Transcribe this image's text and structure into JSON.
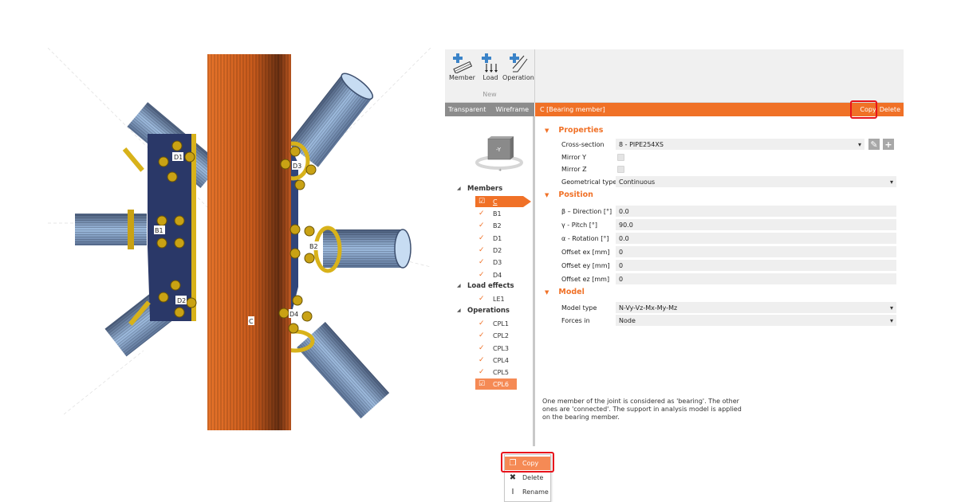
{
  "viewport": {
    "labels": {
      "column": "C",
      "d1": "D1",
      "d2": "D2",
      "d3": "D3",
      "d4": "D4",
      "b1": "B1",
      "b2": "B2"
    },
    "colors": {
      "column": "#e0661e",
      "plate": "#2d3d6e",
      "bolt": "#c8a214",
      "tube": "#8fb0d6"
    }
  },
  "ribbon": {
    "buttons": [
      {
        "label": "Member",
        "icon": "add-member-icon"
      },
      {
        "label": "Load",
        "icon": "add-load-icon"
      },
      {
        "label": "Operation",
        "icon": "add-operation-icon"
      }
    ],
    "group_label": "New"
  },
  "view_toggles": {
    "transparent": "Transparent",
    "wireframe": "Wireframe"
  },
  "view_cube": {
    "face_label": "-Y"
  },
  "tree": {
    "members": {
      "heading": "Members",
      "items": [
        "C",
        "B1",
        "B2",
        "D1",
        "D2",
        "D3",
        "D4"
      ],
      "selected": "C"
    },
    "load_effects": {
      "heading": "Load effects",
      "items": [
        "LE1"
      ]
    },
    "operations": {
      "heading": "Operations",
      "items": [
        "CPL1",
        "CPL2",
        "CPL3",
        "CPL4",
        "CPL5",
        "CPL6"
      ],
      "highlighted": "CPL6"
    }
  },
  "context_menu": {
    "items": [
      {
        "label": "Copy",
        "icon": "copy-icon"
      },
      {
        "label": "Delete",
        "icon": "delete-icon"
      },
      {
        "label": "Rename",
        "icon": "rename-icon"
      }
    ]
  },
  "header": {
    "title": "C  [Bearing member]",
    "copy_label": "Copy",
    "delete_label": "Delete",
    "accent": "#f07127",
    "highlight": "#e8141c"
  },
  "properties": {
    "section_title": "Properties",
    "cross_section_label": "Cross-section",
    "cross_section_value": "8 - PIPE254XS",
    "mirror_y_label": "Mirror Y",
    "mirror_z_label": "Mirror Z",
    "geom_type_label": "Geometrical type",
    "geom_type_value": "Continuous"
  },
  "position": {
    "section_title": "Position",
    "rows": [
      {
        "label": "β – Direction [°]",
        "value": "0.0"
      },
      {
        "label": "γ - Pitch [°]",
        "value": "90.0"
      },
      {
        "label": "α - Rotation [°]",
        "value": "0.0"
      },
      {
        "label": "Offset ex [mm]",
        "value": "0"
      },
      {
        "label": "Offset ey [mm]",
        "value": "0"
      },
      {
        "label": "Offset ez [mm]",
        "value": "0"
      }
    ]
  },
  "model": {
    "section_title": "Model",
    "model_type_label": "Model type",
    "model_type_value": "N-Vy-Vz-Mx-My-Mz",
    "forces_in_label": "Forces in",
    "forces_in_value": "Node"
  },
  "note": "One member of the joint is considered as 'bearing'. The other ones are 'connected'. The support in analysis model is applied on the bearing member."
}
